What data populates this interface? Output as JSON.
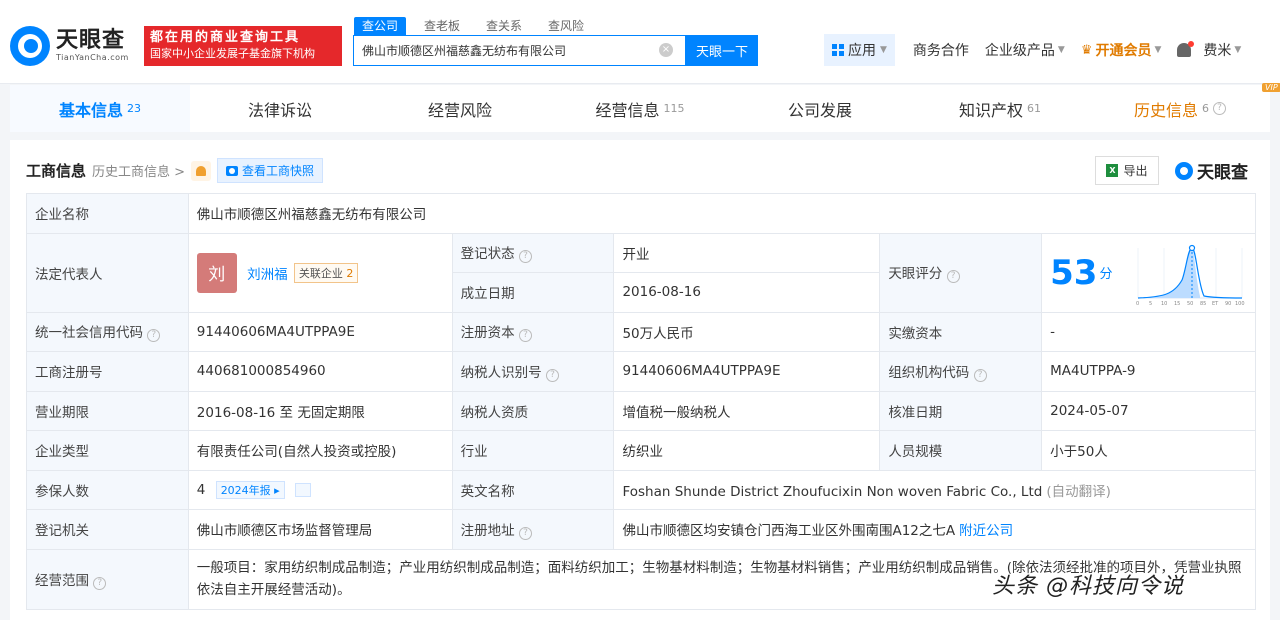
{
  "brand": {
    "name_cn": "天眼查",
    "name_en": "TianYanCha.com"
  },
  "promo": {
    "line1": "都在用的商业查询工具",
    "line2": "国家中小企业发展子基金旗下机构"
  },
  "search": {
    "tabs": [
      "查公司",
      "查老板",
      "查关系",
      "查风险"
    ],
    "value": "佛山市顺德区州福慈鑫无纺布有限公司",
    "button": "天眼一下"
  },
  "nav": {
    "apps": "应用",
    "cooperation": "商务合作",
    "enterprise": "企业级产品",
    "vip": "开通会员",
    "user": "费米"
  },
  "main_tabs": [
    {
      "label": "基本信息",
      "count": "23"
    },
    {
      "label": "法律诉讼",
      "count": ""
    },
    {
      "label": "经营风险",
      "count": ""
    },
    {
      "label": "经营信息",
      "count": "115"
    },
    {
      "label": "公司发展",
      "count": ""
    },
    {
      "label": "知识产权",
      "count": "61"
    },
    {
      "label": "历史信息",
      "count": "6",
      "badge": "VIP"
    }
  ],
  "panel": {
    "title": "工商信息",
    "history_link": "历史工商信息 >",
    "snapshot": "查看工商快照",
    "export": "导出",
    "brand": "天眼查"
  },
  "info": {
    "company_name_label": "企业名称",
    "company_name": "佛山市顺德区州福慈鑫无纺布有限公司",
    "legal_rep_label": "法定代表人",
    "legal_rep_avatar": "刘",
    "legal_rep": "刘洲福",
    "related_label": "关联企业",
    "related_count": "2",
    "reg_status_label": "登记状态",
    "reg_status": "开业",
    "found_date_label": "成立日期",
    "found_date": "2016-08-16",
    "score_label": "天眼评分",
    "score": "53",
    "score_unit": "分",
    "score_axis": [
      "0",
      "5",
      "10",
      "15",
      "50",
      "85",
      "ET",
      "90",
      "100"
    ],
    "credit_code_label": "统一社会信用代码",
    "credit_code": "91440606MA4UTPPA9E",
    "reg_capital_label": "注册资本",
    "reg_capital": "50万人民币",
    "paid_capital_label": "实缴资本",
    "paid_capital": "-",
    "reg_no_label": "工商注册号",
    "reg_no": "440681000854960",
    "taxpayer_id_label": "纳税人识别号",
    "taxpayer_id": "91440606MA4UTPPA9E",
    "org_code_label": "组织机构代码",
    "org_code": "MA4UTPPA-9",
    "term_label": "营业期限",
    "term": "2016-08-16 至 无固定期限",
    "taxpayer_qual_label": "纳税人资质",
    "taxpayer_qual": "增值税一般纳税人",
    "approve_date_label": "核准日期",
    "approve_date": "2024-05-07",
    "type_label": "企业类型",
    "type": "有限责任公司(自然人投资或控股)",
    "industry_label": "行业",
    "industry": "纺织业",
    "staff_label": "人员规模",
    "staff": "小于50人",
    "insured_label": "参保人数",
    "insured": "4",
    "insured_report": "2024年报",
    "en_name_label": "英文名称",
    "en_name": "Foshan Shunde District Zhoufucixin Non woven Fabric Co., Ltd",
    "auto_translate": "(自动翻译)",
    "authority_label": "登记机关",
    "authority": "佛山市顺德区市场监督管理局",
    "address_label": "注册地址",
    "address": "佛山市顺德区均安镇仓门西海工业区外围南围A12之七A",
    "nearby": "附近公司",
    "scope_label": "经营范围",
    "scope": "一般项目：家用纺织制成品制造；产业用纺织制成品制造；面料纺织加工；生物基材料制造；生物基材料销售；产业用纺织制成品销售。(除依法须经批准的项目外，凭营业执照依法自主开展经营活动)。"
  },
  "watermark": "头条 @科技向令说",
  "colors": {
    "accent": "#0084ff",
    "promo": "#e5282b",
    "vip": "#e07b00",
    "status": "#18a058"
  }
}
